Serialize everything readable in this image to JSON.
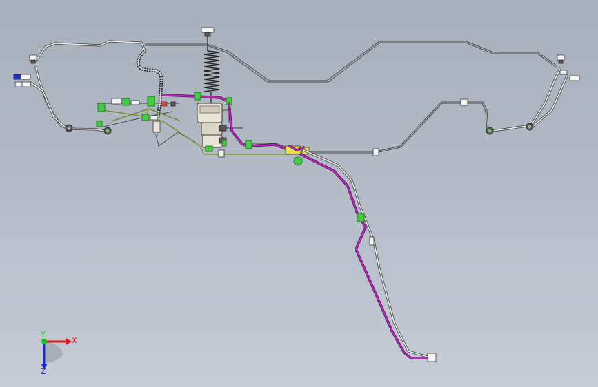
{
  "viewport": {
    "background_top": "#a7afbc",
    "background_bottom": "#c6ccd6"
  },
  "colors": {
    "tube": "#eeeeee",
    "tube_outline": "#3d3d3d",
    "brake_line": "#c41ec4",
    "fitting": "#3ecf3e",
    "valve_body": "#e9e4d6"
  },
  "triad": {
    "x_label": "X",
    "y_label": "Y",
    "z_label": "Z",
    "x_color": "#e01818",
    "y_color": "#19c219",
    "z_color": "#1a2ad8"
  }
}
